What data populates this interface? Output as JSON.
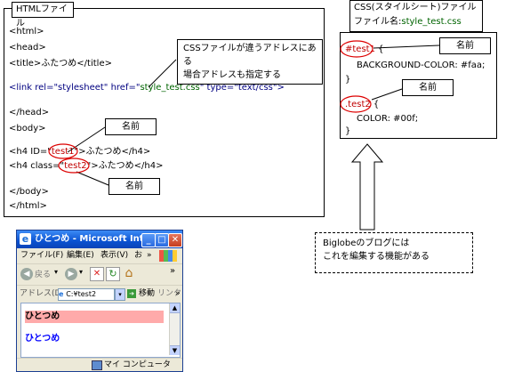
{
  "html_panel": {
    "title": "HTMLファイル",
    "lines": {
      "l1": "<html>",
      "l2": "<head>",
      "l3": "<title>ふたつめ</title>",
      "link_open": "<link rel=\"stylesheet\" href=\"",
      "link_href": "style_test.css",
      "link_rest": "\"   type=\"text/css\">",
      "l5": "</head>",
      "l6": "<body>",
      "h4a_pre": "<h4 ID=\"",
      "h4a_id": "test1",
      "h4a_post": "\">ふたつめ</h4>",
      "h4b_pre": "<h4 class=\"",
      "h4b_class": "test2",
      "h4b_post": "\">ふたつめ</h4>",
      "l9": "</body>",
      "l10": "</html>"
    },
    "callout_line1": "CSSファイルが違うアドレスにある",
    "callout_line2": "場合アドレスも指定する",
    "name_label_1": "名前",
    "name_label_2": "名前"
  },
  "css_panel": {
    "title_line1": "CSS(スタイルシート)ファイル",
    "title_line2_prefix": "ファイル名:",
    "title_filename": "style_test.css",
    "sel1": "#test1",
    "brace_open1": " {",
    "rule1": "BACKGROUND-COLOR: #faa;",
    "close1": "}",
    "sel2": ".test2",
    "brace_open2": " {",
    "rule2": "COLOR: #00f;",
    "close2": "}",
    "name_label_1": "名前",
    "name_label_2": "名前"
  },
  "note": {
    "line1": "Biglobeのブログには",
    "line2": "これを編集する機能がある"
  },
  "browser": {
    "title": "ひとつめ - Microsoft Int...",
    "menu": [
      "ファイル(F)",
      "編集(E)",
      "表示(V)",
      "お"
    ],
    "menu_more": "»",
    "back_label": "戻る",
    "toolbar_more": "»",
    "address_label": "アドレス(D)",
    "address_value": "C:¥test2",
    "go_label": "移動",
    "links_label": "リンク",
    "content_line1": "ひとつめ",
    "content_line2": "ひとつめ",
    "status": "マイ コンピュータ",
    "colors": {
      "highlight": "#ffaaaa",
      "link_text": "#0000ff"
    }
  }
}
